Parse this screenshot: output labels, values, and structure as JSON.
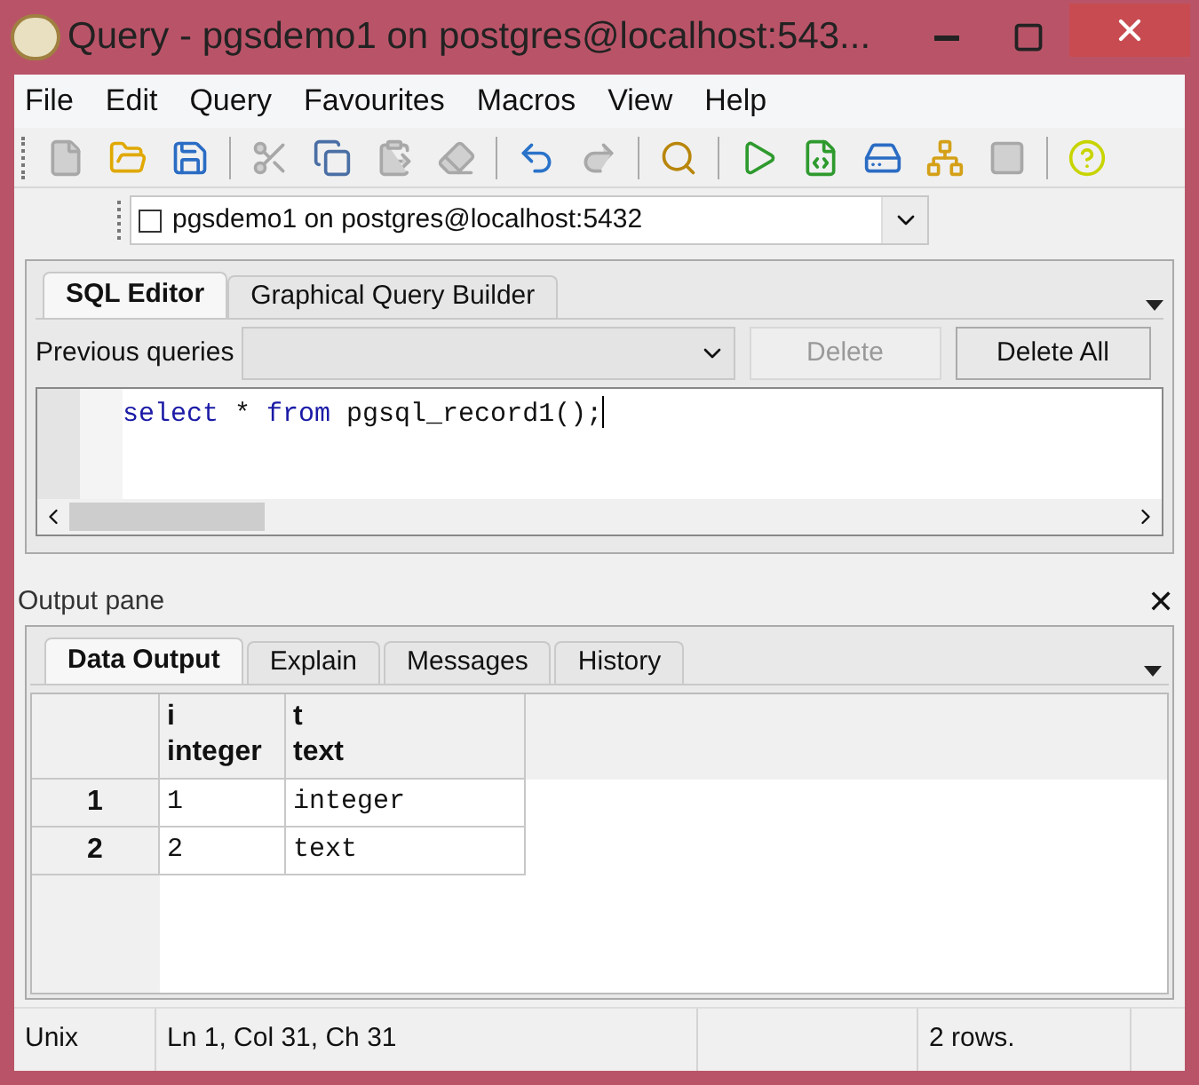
{
  "window": {
    "title": "Query - pgsdemo1 on postgres@localhost:543..."
  },
  "menu": [
    "File",
    "Edit",
    "Query",
    "Favourites",
    "Macros",
    "View",
    "Help"
  ],
  "toolbar": [
    {
      "kind": "new",
      "disabled": true
    },
    {
      "kind": "open",
      "disabled": false
    },
    {
      "kind": "save",
      "disabled": false
    },
    {
      "kind": "sep"
    },
    {
      "kind": "cut",
      "disabled": true
    },
    {
      "kind": "copy",
      "disabled": false
    },
    {
      "kind": "paste",
      "disabled": true
    },
    {
      "kind": "clear",
      "disabled": true
    },
    {
      "kind": "sep"
    },
    {
      "kind": "undo",
      "disabled": false
    },
    {
      "kind": "redo",
      "disabled": true
    },
    {
      "kind": "sep"
    },
    {
      "kind": "find",
      "disabled": false
    },
    {
      "kind": "sep"
    },
    {
      "kind": "run",
      "disabled": false
    },
    {
      "kind": "script",
      "disabled": false
    },
    {
      "kind": "tofile",
      "disabled": false
    },
    {
      "kind": "explain",
      "disabled": false
    },
    {
      "kind": "stop",
      "disabled": true
    },
    {
      "kind": "sep"
    },
    {
      "kind": "help",
      "disabled": false
    }
  ],
  "connection": {
    "value": "pgsdemo1 on postgres@localhost:5432",
    "checked": false
  },
  "editor_tabs": [
    {
      "label": "SQL Editor",
      "selected": true
    },
    {
      "label": "Graphical Query Builder",
      "selected": false
    }
  ],
  "previous_queries": {
    "label": "Previous queries",
    "delete": {
      "label": "Delete",
      "disabled": true
    },
    "delete_all": {
      "label": "Delete All",
      "disabled": false
    }
  },
  "sql": {
    "code": [
      {
        "kind": "kw",
        "text": "select"
      },
      {
        "kind": "plain",
        "text": " * "
      },
      {
        "kind": "kw",
        "text": "from"
      },
      {
        "kind": "plain",
        "text": " pgsql_record1();"
      }
    ]
  },
  "output_pane": {
    "title": "Output pane",
    "close": "✕"
  },
  "output_tabs": [
    {
      "label": "Data Output",
      "selected": true
    },
    {
      "label": "Explain",
      "selected": false
    },
    {
      "label": "Messages",
      "selected": false
    },
    {
      "label": "History",
      "selected": false
    }
  ],
  "table": {
    "columns": [
      {
        "name": "i",
        "type": "integer"
      },
      {
        "name": "t",
        "type": "text"
      }
    ],
    "rows": [
      {
        "num": "1",
        "cells": [
          "1",
          "integer"
        ]
      },
      {
        "num": "2",
        "cells": [
          "2",
          "text"
        ]
      }
    ]
  },
  "status_bar": [
    "Unix",
    "Ln 1, Col 31, Ch 31",
    "2 rows."
  ]
}
